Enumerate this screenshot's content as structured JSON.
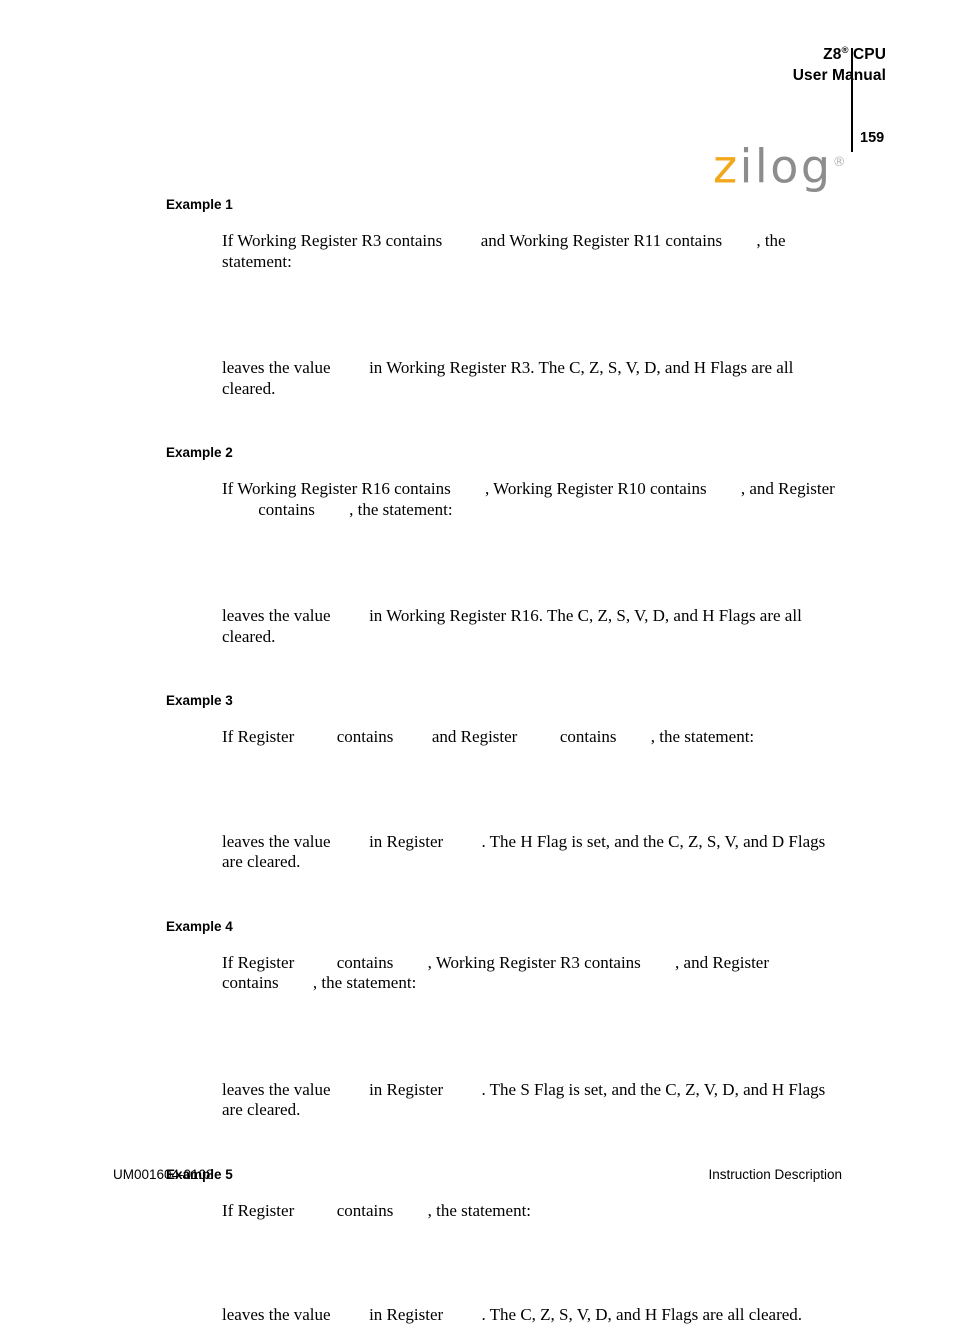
{
  "header": {
    "title_line1_prefix": "Z8",
    "title_line1_sup": "®",
    "title_line1_suffix": " CPU",
    "title_line2": "User Manual",
    "page_number": "159",
    "logo_first_letter": "z",
    "logo_rest": "ilog",
    "logo_trademark": "®",
    "logo_color_z": "#f2a81d",
    "logo_color_rest": "#8d8d8d"
  },
  "examples": [
    {
      "heading": "Example 1",
      "condition_parts": [
        "If Working Register R3 contains ",
        " and Working Register R11 contains ",
        ", the statement:"
      ],
      "result_parts": [
        "leaves the value ",
        " in Working Register R3. The C, Z, S, V, D, and H Flags are all cleared."
      ]
    },
    {
      "heading": "Example 2",
      "condition_parts": [
        "If Working Register R16 contains ",
        ", Working Register R10 contains ",
        ", and Register ",
        " contains ",
        ", the statement:"
      ],
      "result_parts": [
        "leaves the value ",
        " in Working Register R16. The C, Z, S, V, D, and H Flags are all cleared."
      ]
    },
    {
      "heading": "Example 3",
      "condition_parts": [
        "If Register ",
        " contains ",
        " and Register ",
        " contains ",
        ", the statement:"
      ],
      "result_parts": [
        "leaves the value ",
        " in Register ",
        ". The H Flag is set, and the C, Z, S, V, and D Flags are cleared."
      ]
    },
    {
      "heading": "Example 4",
      "condition_parts": [
        "If Register ",
        " contains ",
        ", Working Register R3 contains ",
        ", and Register ",
        " contains ",
        ", the statement:"
      ],
      "result_parts": [
        "leaves the value ",
        " in Register ",
        ". The S Flag is set, and the C, Z, V, D, and H Flags are cleared."
      ]
    },
    {
      "heading": "Example 5",
      "condition_parts": [
        "If Register ",
        " contains ",
        ", the statement:"
      ],
      "result_parts": [
        "leaves the value ",
        " in Register ",
        ". The C, Z, S, V, D, and H Flags are all cleared."
      ]
    }
  ],
  "footer": {
    "document_number": "UM001604-0108",
    "section_title": "Instruction Description"
  }
}
